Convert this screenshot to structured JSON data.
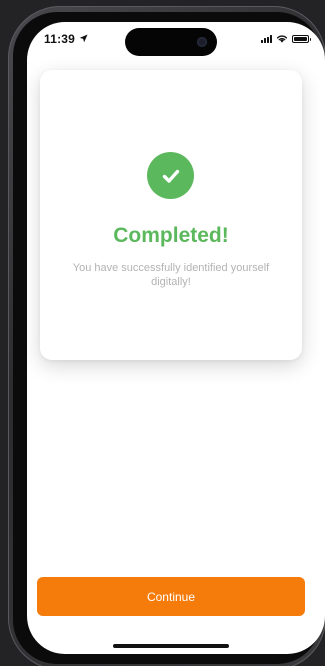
{
  "status_bar": {
    "time": "11:39",
    "icons": [
      "location-arrow-icon",
      "signal-icon",
      "wifi-icon",
      "battery-icon"
    ]
  },
  "card": {
    "icon": "checkmark-circle-icon",
    "title": "Completed!",
    "message": "You have successfully identified yourself digitally!"
  },
  "actions": {
    "continue_label": "Continue"
  },
  "colors": {
    "success_green": "#5cb85c",
    "accent_orange": "#f57c0a",
    "message_gray": "#b3b3b3",
    "background": "#232325"
  }
}
